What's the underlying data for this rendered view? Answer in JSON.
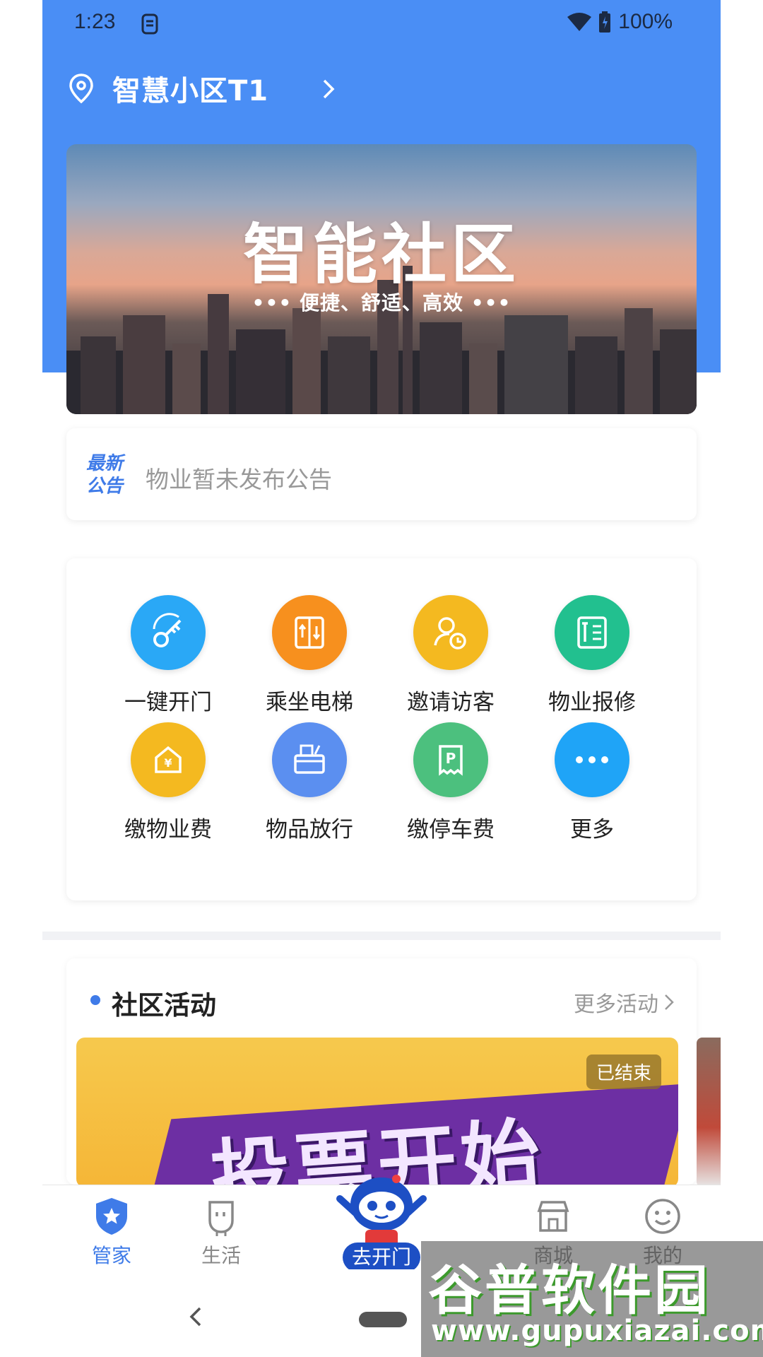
{
  "status_bar": {
    "time": "1:23",
    "battery": "100%"
  },
  "location": {
    "name": "智慧小区T1"
  },
  "banner": {
    "title": "智能社区",
    "subtitle": "••• 便捷、舒适、高效 •••"
  },
  "notice": {
    "tag_line1": "最新",
    "tag_line2": "公告",
    "text": "物业暂未发布公告"
  },
  "services": [
    {
      "label": "一键开门",
      "icon": "key-icon",
      "color": "#2aa8f6"
    },
    {
      "label": "乘坐电梯",
      "icon": "elevator-icon",
      "color": "#f7901e"
    },
    {
      "label": "邀请访客",
      "icon": "visitor-icon",
      "color": "#f4b920"
    },
    {
      "label": "物业报修",
      "icon": "repair-icon",
      "color": "#22c08f"
    },
    {
      "label": "缴物业费",
      "icon": "fee-house-icon",
      "color": "#f4b920"
    },
    {
      "label": "物品放行",
      "icon": "item-release-icon",
      "color": "#5b8ff0"
    },
    {
      "label": "缴停车费",
      "icon": "parking-fee-icon",
      "color": "#4cc07e"
    },
    {
      "label": "更多",
      "icon": "more-dots-icon",
      "color": "#1fa4f7"
    }
  ],
  "activities": {
    "title": "社区活动",
    "more": "更多活动",
    "item": {
      "poster_text": "投票开始",
      "status": "已结束"
    }
  },
  "bottom_nav": [
    {
      "label": "管家",
      "icon": "shield-star-icon",
      "active": true
    },
    {
      "label": "生活",
      "icon": "life-icon",
      "active": false
    },
    {
      "label": "去开门",
      "icon": "robot-mascot-icon",
      "active": false
    },
    {
      "label": "商城",
      "icon": "shop-icon",
      "active": false
    },
    {
      "label": "我的",
      "icon": "smile-icon",
      "active": false
    }
  ],
  "watermark": {
    "title": "谷普软件园",
    "url": "www.gupuxiazai.com"
  }
}
